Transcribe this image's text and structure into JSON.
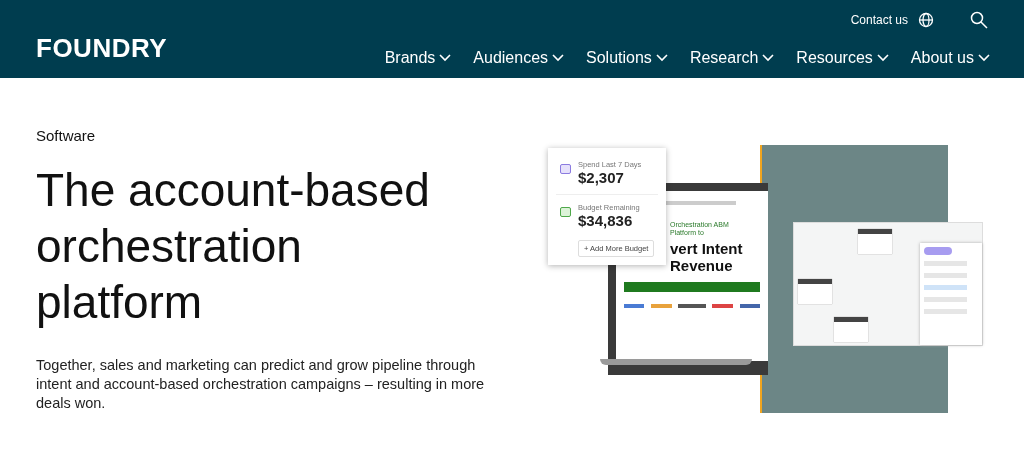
{
  "header": {
    "logo": "FOUNDRY",
    "contact": "Contact us",
    "nav": [
      {
        "label": "Brands"
      },
      {
        "label": "Audiences"
      },
      {
        "label": "Solutions"
      },
      {
        "label": "Research"
      },
      {
        "label": "Resources"
      },
      {
        "label": "About us"
      }
    ]
  },
  "hero": {
    "eyebrow": "Software",
    "title_lines": [
      "The account-based",
      "orchestration",
      "platform"
    ],
    "description": "Together, sales and marketing can predict and grow pipeline through intent and account-based orchestration campaigns – resulting in more deals won."
  },
  "image": {
    "card": [
      {
        "label": "Spend Last 7 Days",
        "value": "$2,307",
        "kind": "spend"
      },
      {
        "label": "Budget Remaining",
        "value": "$34,836",
        "kind": "budget"
      }
    ],
    "card_button": "+ Add More Budget",
    "laptop": {
      "kicker": "Orchestration ABM Platform to",
      "headline_lines": [
        "vert Intent",
        "Revenue"
      ]
    }
  }
}
